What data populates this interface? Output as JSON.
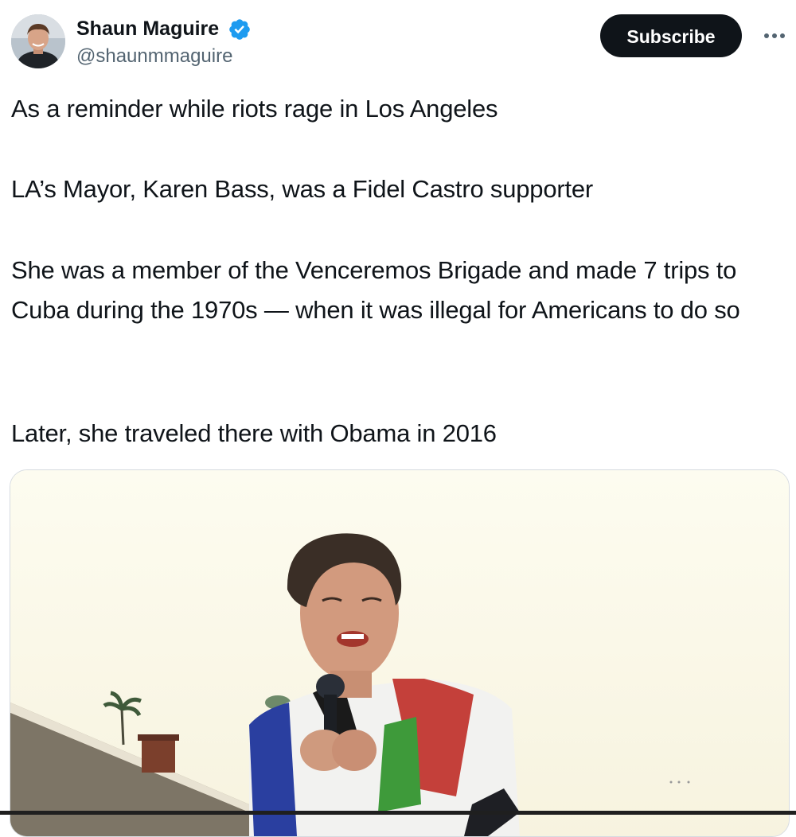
{
  "author": {
    "display_name": "Shaun Maguire",
    "handle": "@shaunmmaguire",
    "avatar_icon": "profile-photo",
    "verified_icon": "verified-badge-icon",
    "verified_color": "#1d9bf0"
  },
  "actions": {
    "subscribe_label": "Subscribe",
    "more_icon": "more-options-icon"
  },
  "tweet": {
    "paragraphs": [
      "As a reminder while riots rage in Los Angeles",
      "LA’s Mayor, Karen Bass, was a Fidel Castro supporter",
      "She was a member of the Venceremos Brigade and made 7 trips to Cuba during the 1970s — when it was illegal for Americans to do so",
      "Later, she traveled there with Obama in 2016"
    ]
  },
  "media": {
    "type": "photo"
  },
  "colors": {
    "text_primary": "#0f1419",
    "text_secondary": "#536471",
    "button_bg": "#0f1419",
    "button_text": "#ffffff"
  }
}
